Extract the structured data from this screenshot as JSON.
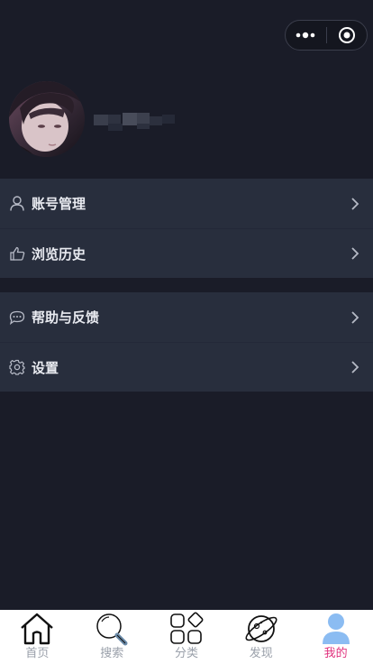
{
  "menu_groups": [
    {
      "items": [
        {
          "label": "账号管理",
          "icon": "user-icon"
        },
        {
          "label": "浏览历史",
          "icon": "thumbs-up-icon"
        }
      ]
    },
    {
      "items": [
        {
          "label": "帮助与反馈",
          "icon": "chat-bubble-icon"
        },
        {
          "label": "设置",
          "icon": "gear-icon"
        }
      ]
    }
  ],
  "tabbar": {
    "tabs": [
      {
        "label": "首页",
        "icon": "home-icon"
      },
      {
        "label": "搜索",
        "icon": "search-icon"
      },
      {
        "label": "分类",
        "icon": "category-icon"
      },
      {
        "label": "发现",
        "icon": "planet-icon"
      },
      {
        "label": "我的",
        "icon": "person-icon",
        "active": true
      }
    ]
  },
  "colors": {
    "background": "#1a1c28",
    "menu_background": "#282e3d",
    "active_tab": "#e0317d"
  }
}
